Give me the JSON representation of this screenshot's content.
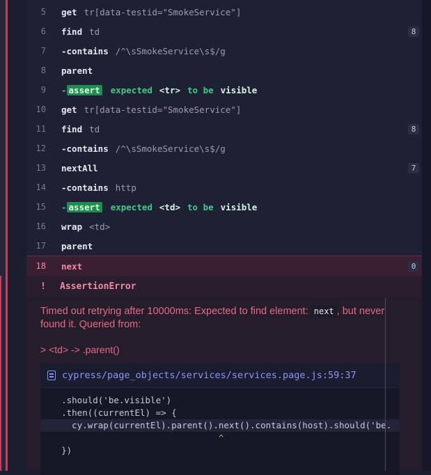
{
  "log": {
    "rows": [
      {
        "num": "5",
        "cmd": "get",
        "dash": false,
        "arg": "tr[data-testid=\"SmokeService\"]"
      },
      {
        "num": "6",
        "cmd": "find",
        "dash": false,
        "arg": "td",
        "count": "8"
      },
      {
        "num": "7",
        "cmd": "contains",
        "dash": true,
        "arg": "/^\\sSmokeService\\s$/g"
      },
      {
        "num": "8",
        "cmd": "parent",
        "dash": false,
        "arg": ""
      },
      {
        "num": "9",
        "cmd": "assert",
        "dash": true,
        "assert": true,
        "parts": [
          "expected",
          "<tr>",
          "to be",
          "visible"
        ]
      },
      {
        "num": "10",
        "cmd": "get",
        "dash": false,
        "arg": "tr[data-testid=\"SmokeService\"]"
      },
      {
        "num": "11",
        "cmd": "find",
        "dash": false,
        "arg": "td",
        "count": "8"
      },
      {
        "num": "12",
        "cmd": "contains",
        "dash": true,
        "arg": "/^\\sSmokeService\\s$/g"
      },
      {
        "num": "13",
        "cmd": "nextAll",
        "dash": false,
        "arg": "",
        "count": "7"
      },
      {
        "num": "14",
        "cmd": "contains",
        "dash": true,
        "arg": "http"
      },
      {
        "num": "15",
        "cmd": "assert",
        "dash": true,
        "assert": true,
        "parts": [
          "expected",
          "<td>",
          "to be",
          "visible"
        ]
      },
      {
        "num": "16",
        "cmd": "wrap",
        "dash": false,
        "arg": "<td>"
      },
      {
        "num": "17",
        "cmd": "parent",
        "dash": false,
        "arg": ""
      },
      {
        "num": "18",
        "cmd": "next",
        "dash": false,
        "arg": "",
        "count": "0",
        "failed": true
      }
    ]
  },
  "error": {
    "bang": "!",
    "title": "AssertionError",
    "message_before": "Timed out retrying after 10000ms: Expected to find element:",
    "message_code": "next",
    "message_after": ", but never found it. Queried from:",
    "query": "> <td> -> .parent()",
    "file_link": "cypress/page_objects/services/services.page.js:59:37",
    "code_lines": [
      "    .should('be.visible')",
      "    .then((currentEl) => {",
      "      cy.wrap(currentEl).parent().next().contains(host).should('be.",
      "                                  ^",
      "    })"
    ]
  },
  "colors": {
    "accent_red": "#c3405c",
    "assert_green": "#1e8d4f",
    "link_purple": "#8f93f5"
  }
}
